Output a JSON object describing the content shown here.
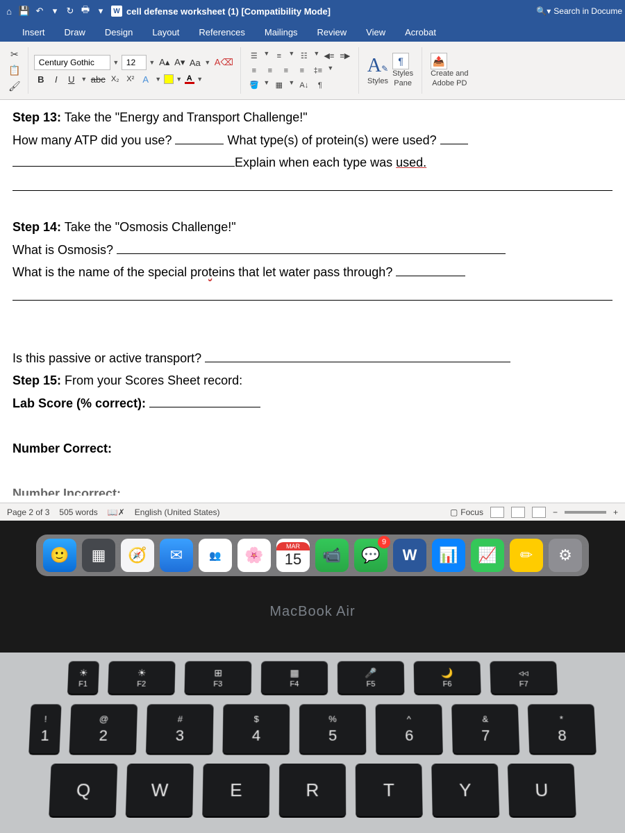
{
  "titlebar": {
    "doc_title": "cell defense worksheet (1) [Compatibility Mode]",
    "search_placeholder": "Search in Docume"
  },
  "tabs": [
    "Insert",
    "Draw",
    "Design",
    "Layout",
    "References",
    "Mailings",
    "Review",
    "View",
    "Acrobat"
  ],
  "font": {
    "name": "Century Gothic",
    "size": "12"
  },
  "ribbon": {
    "grow": "A",
    "shrink": "A",
    "case": "Aa",
    "clear": "A",
    "bold": "B",
    "italic": "I",
    "underline": "U",
    "strike": "abc",
    "sub": "X₂",
    "sup": "X²",
    "effects": "A",
    "highlight": "ab",
    "fontcolor": "A",
    "styles": "Styles",
    "styles_pane": "Styles\nPane",
    "adobe": "Create and\nAdobe PD"
  },
  "document": {
    "step13_label": "Step 13:",
    "step13_text": " Take the \"Energy and Transport Challenge!\"",
    "atp_q": "How many ATP did you use? ",
    "protein_q": " What type(s) of protein(s) were used? ",
    "explain_q": "Explain when each type was ",
    "used": "used.",
    "step14_label": "Step 14:",
    "step14_text": " Take the \"Osmosis Challenge!\"",
    "osmosis_q": "What is Osmosis? ",
    "special_q": "What is the name of the special pro",
    "special_typo": "t",
    "special_q2": "eins that let water pass through? ",
    "passive_q": "Is this passive or active transport? ",
    "step15_label": "Step 15:",
    "step15_text": " From your Scores Sheet record:",
    "lab_score": "Lab Score (% correct): ",
    "num_correct": "Number Correct:",
    "num_incorrect": "Number Incorrect:"
  },
  "statusbar": {
    "page": "Page 2 of 3",
    "words": "505 words",
    "lang": "English (United States)",
    "focus": "Focus"
  },
  "dock": {
    "cal_month": "MAR",
    "cal_day": "15",
    "msg_badge": "9"
  },
  "laptop": "MacBook Air",
  "keys": {
    "fn": [
      {
        "sym": "☀",
        "lab": "F1"
      },
      {
        "sym": "☀",
        "lab": "F2"
      },
      {
        "sym": "⊞",
        "lab": "F3"
      },
      {
        "sym": "▦",
        "lab": "F4"
      },
      {
        "sym": "🎤",
        "lab": "F5"
      },
      {
        "sym": "🌙",
        "lab": "F6"
      },
      {
        "sym": "◃◃",
        "lab": "F7"
      }
    ],
    "num": [
      {
        "t": "!",
        "b": "1"
      },
      {
        "t": "@",
        "b": "2"
      },
      {
        "t": "#",
        "b": "3"
      },
      {
        "t": "$",
        "b": "4"
      },
      {
        "t": "%",
        "b": "5"
      },
      {
        "t": "^",
        "b": "6"
      },
      {
        "t": "&",
        "b": "7"
      },
      {
        "t": "*",
        "b": "8"
      }
    ],
    "letters": [
      "Q",
      "W",
      "E",
      "R",
      "T",
      "Y",
      "U"
    ]
  }
}
